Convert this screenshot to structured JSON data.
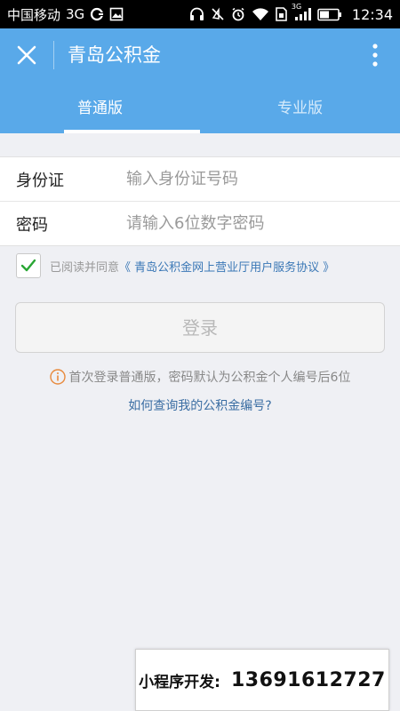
{
  "status_bar": {
    "carrier": "中国移动",
    "network": "3G",
    "network_small": "3G",
    "time": "12:34",
    "icons": [
      "sync-icon",
      "gallery-icon",
      "headphones-icon",
      "mute-icon",
      "alarm-icon",
      "wifi-icon",
      "sim-icon",
      "signal-icon",
      "battery-icon"
    ]
  },
  "header": {
    "title": "青岛公积金",
    "background_color": "#59a9e9",
    "tabs": [
      {
        "label": "普通版",
        "active": true
      },
      {
        "label": "专业版",
        "active": false
      }
    ]
  },
  "form": {
    "id_label": "身份证",
    "id_placeholder": "输入身份证号码",
    "password_label": "密码",
    "password_placeholder": "请输入6位数字密码"
  },
  "agreement": {
    "checked": true,
    "prefix": "已阅读并同意",
    "link_text": "《 青岛公积金网上营业厅用户服务协议 》"
  },
  "login_button": {
    "label": "登录"
  },
  "hint": {
    "text": "首次登录普通版，密码默认为公积金个人编号后6位",
    "help_link": "如何查询我的公积金编号?"
  },
  "promo": {
    "label": "小程序开发:",
    "phone": "13691612727"
  }
}
